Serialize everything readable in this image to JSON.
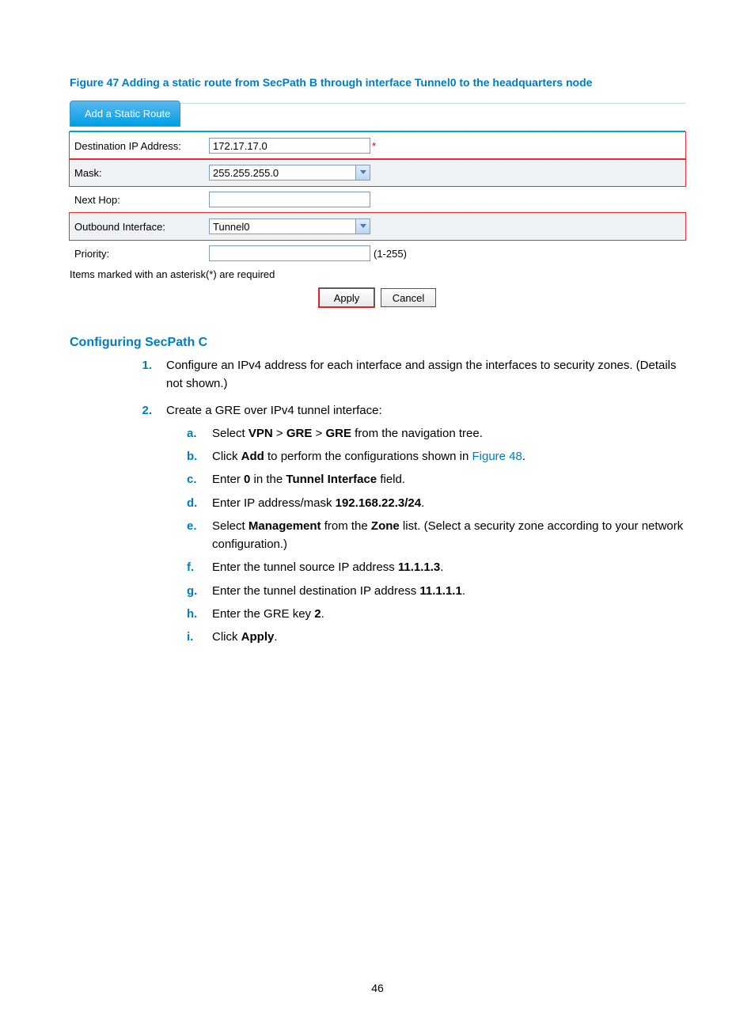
{
  "figure": {
    "caption": "Figure 47 Adding a static route from SecPath B through interface Tunnel0 to the headquarters node",
    "tab_label": "Add a Static Route",
    "rows": {
      "dest_ip_label": "Destination IP Address:",
      "dest_ip_value": "172.17.17.0",
      "mask_label": "Mask:",
      "mask_value": "255.255.255.0",
      "next_hop_label": "Next Hop:",
      "next_hop_value": "",
      "out_if_label": "Outbound Interface:",
      "out_if_value": "Tunnel0",
      "priority_label": "Priority:",
      "priority_value": "",
      "priority_range": "(1-255)"
    },
    "req_note": "Items marked with an asterisk(*) are required",
    "apply": "Apply",
    "cancel": "Cancel",
    "asterisk": "*"
  },
  "heading": "Configuring SecPath C",
  "steps": {
    "s1": "Configure an IPv4 address for each interface and assign the interfaces to security zones. (Details not shown.)",
    "s2": "Create a GRE over IPv4 tunnel interface:",
    "a_pre": "Select ",
    "a_b1": "VPN",
    "a_mid1": " > ",
    "a_b2": "GRE",
    "a_mid2": " > ",
    "a_b3": "GRE",
    "a_post": " from the navigation tree.",
    "b_pre": "Click ",
    "b_b1": "Add",
    "b_mid": " to perform the configurations shown in ",
    "b_link": "Figure 48",
    "b_post": ".",
    "c_pre": "Enter ",
    "c_b1": "0",
    "c_mid": " in the ",
    "c_b2": "Tunnel Interface",
    "c_post": " field.",
    "d_pre": "Enter IP address/mask ",
    "d_b1": "192.168.22.3/24",
    "d_post": ".",
    "e_pre": "Select ",
    "e_b1": "Management",
    "e_mid": " from the ",
    "e_b2": "Zone",
    "e_post": " list. (Select a security zone according to your network configuration.)",
    "f_pre": "Enter the tunnel source IP address ",
    "f_b1": "11.1.1.3",
    "f_post": ".",
    "g_pre": "Enter the tunnel destination IP address ",
    "g_b1": "11.1.1.1",
    "g_post": ".",
    "h_pre": "Enter the GRE key ",
    "h_b1": "2",
    "h_post": ".",
    "i_pre": "Click ",
    "i_b1": "Apply",
    "i_post": "."
  },
  "markers": {
    "m1": "1.",
    "m2": "2.",
    "ma": "a.",
    "mb": "b.",
    "mc": "c.",
    "md": "d.",
    "me": "e.",
    "mf": "f.",
    "mg": "g.",
    "mh": "h.",
    "mi": "i."
  },
  "page_number": "46"
}
